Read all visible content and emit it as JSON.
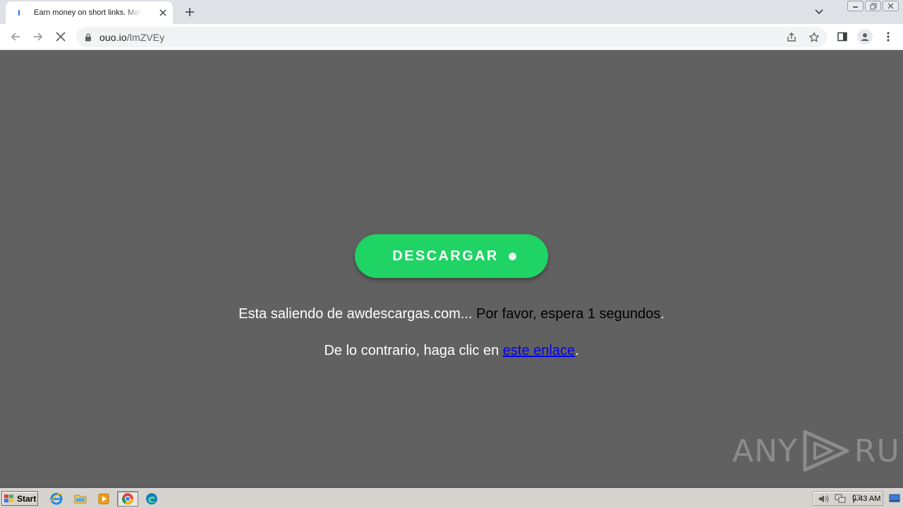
{
  "browser": {
    "tab": {
      "title": "Earn money on short links. Make short links and earn the biggest money",
      "close_icon": "close-icon",
      "favicon": "ouo-favicon"
    },
    "new_tab_icon": "plus-icon",
    "tab_search_icon": "chevron-down-icon",
    "omnibox": {
      "domain": "ouo.io",
      "path": "/lmZVEy"
    },
    "icons": [
      "back-arrow-icon",
      "forward-arrow-icon",
      "stop-loading-icon",
      "lock-icon",
      "share-icon",
      "star-icon",
      "side-panel-icon",
      "profile-icon",
      "menu-icon"
    ]
  },
  "page": {
    "background_color": "#616161",
    "download_button": {
      "label": "DESCARGAR",
      "color": "#1fd364"
    },
    "message1": {
      "part1": "Esta saliendo de awdescargas.com... ",
      "part2": "Por favor, espera 1 segundos",
      "part3": "."
    },
    "message2": {
      "prefix": "De lo contrario, haga clic en ",
      "link_text": "este enlace",
      "suffix": "."
    },
    "watermark": {
      "left": "ANY",
      "right": "RUN"
    }
  },
  "taskbar": {
    "start_label": "Start",
    "apps": [
      "internet-explorer-icon",
      "folder-icon",
      "media-player-icon",
      "chrome-icon",
      "edge-icon"
    ],
    "tray_icons": [
      "volume-icon",
      "network-icon",
      "flag-icon"
    ],
    "clock": "9:43 AM"
  }
}
